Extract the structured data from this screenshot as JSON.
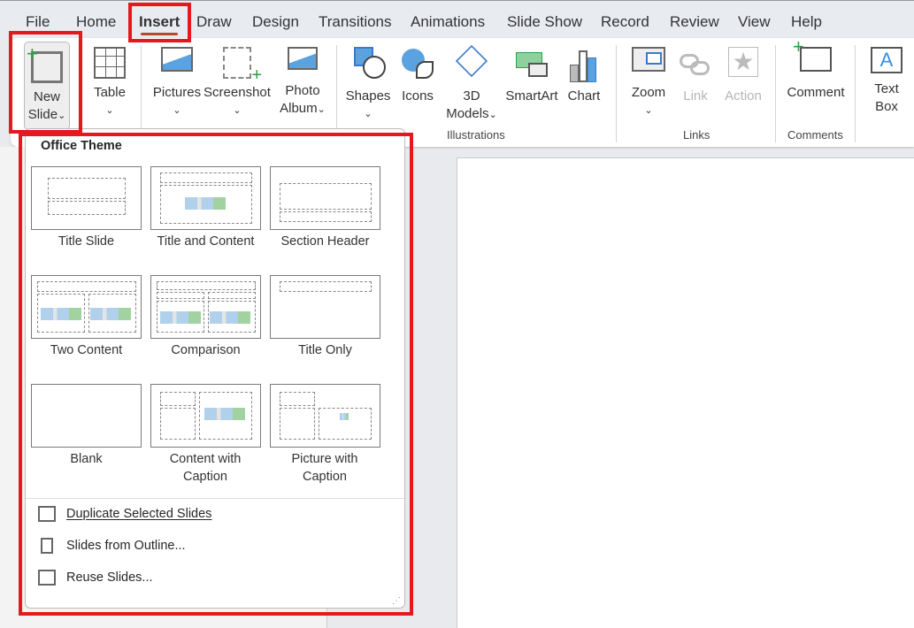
{
  "tabs": [
    "File",
    "Home",
    "Insert",
    "Draw",
    "Design",
    "Transitions",
    "Animations",
    "Slide Show",
    "Record",
    "Review",
    "View",
    "Help"
  ],
  "active_tab": "Insert",
  "ribbon": {
    "new_slide": [
      "New",
      "Slide"
    ],
    "table": "Table",
    "pictures": "Pictures",
    "screenshot": "Screenshot",
    "photo_album": [
      "Photo",
      "Album"
    ],
    "shapes": "Shapes",
    "icons": "Icons",
    "models": [
      "3D",
      "Models"
    ],
    "smartart": "SmartArt",
    "chart": "Chart",
    "zoom": "Zoom",
    "link": "Link",
    "action": "Action",
    "comment": "Comment",
    "textbox": [
      "Text",
      "Box"
    ],
    "groups": {
      "illustrations": "Illustrations",
      "links": "Links",
      "comments": "Comments"
    }
  },
  "menu": {
    "heading": "Office Theme",
    "layouts": [
      {
        "label": "Title Slide"
      },
      {
        "label": "Title and Content"
      },
      {
        "label": "Section Header"
      },
      {
        "label": "Two Content"
      },
      {
        "label": "Comparison"
      },
      {
        "label": "Title Only"
      },
      {
        "label": "Blank"
      },
      {
        "label": "Content with Caption"
      },
      {
        "label": "Picture with Caption"
      }
    ],
    "items": [
      "Duplicate Selected Slides",
      "Slides from Outline...",
      "Reuse Slides..."
    ]
  },
  "colors": {
    "highlight": "#e3191f",
    "accent": "#b7472a"
  }
}
